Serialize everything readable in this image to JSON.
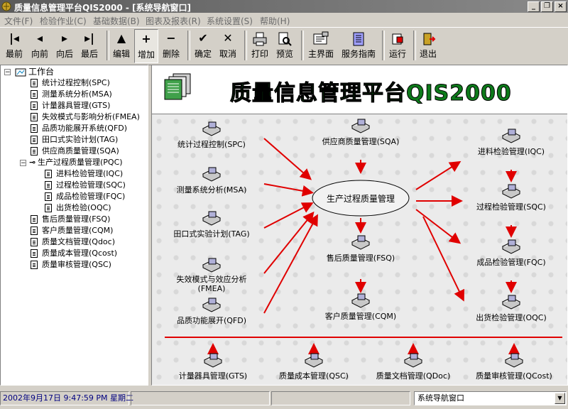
{
  "window": {
    "title": "质量信息管理平台QIS2000 - [系统导航窗口]",
    "controls": {
      "minimize": "_",
      "restore": "❐",
      "close": "×"
    }
  },
  "menu": [
    {
      "label": "文件(F)"
    },
    {
      "label": "检验作业(C)"
    },
    {
      "label": "基础数据(B)"
    },
    {
      "label": "图表及报表(R)"
    },
    {
      "label": "系统设置(S)"
    },
    {
      "label": "帮助(H)"
    }
  ],
  "toolbar": {
    "first": "最前",
    "prev": "向前",
    "next": "向后",
    "last": "最后",
    "edit": "编辑",
    "add": "增加",
    "delete": "删除",
    "confirm": "确定",
    "cancel": "取消",
    "print": "打印",
    "preview": "预览",
    "main": "主界面",
    "service": "服务指南",
    "run": "运行",
    "exit": "退出"
  },
  "tree": {
    "root": "工作台",
    "items": [
      {
        "label": "统计过程控制(SPC)"
      },
      {
        "label": "测量系统分析(MSA)"
      },
      {
        "label": "计量器具管理(GTS)"
      },
      {
        "label": "失效模式与影响分析(FMEA)"
      },
      {
        "label": "品质功能展开系统(QFD)"
      },
      {
        "label": "田口式实验计划(TAG)"
      },
      {
        "label": "供应商质量管理(SQA)"
      },
      {
        "label": "生产过程质量管理(PQC)"
      },
      {
        "label": "进料检验管理(IQC)"
      },
      {
        "label": "过程检验管理(SQC)"
      },
      {
        "label": "成品检验管理(FQC)"
      },
      {
        "label": "出货检验(OQC)"
      },
      {
        "label": "售后质量管理(FSQ)"
      },
      {
        "label": "客户质量管理(CQM)"
      },
      {
        "label": "质量文档管理(Qdoc)"
      },
      {
        "label": "质量成本管理(Qcost)"
      },
      {
        "label": "质量审核管理(QSC)"
      }
    ]
  },
  "banner": {
    "title": "质量信息管理平台QIS2000"
  },
  "diagram": {
    "spc": "统计过程控制(SPC)",
    "msa": "测量系统分析(MSA)",
    "tag": "田口式实验计划(TAG)",
    "fmea_line1": "失效模式与效应分析",
    "fmea_line2": "(FMEA)",
    "qfd": "品质功能展开(QFD)",
    "sqa": "供应商质量管理(SQA)",
    "pqc": "生产过程质量管理",
    "fsq": "售后质量管理(FSQ)",
    "cqm": "客户质量管理(CQM)",
    "iqc": "进料检验管理(IQC)",
    "sqc": "过程检验管理(SQC)",
    "fqc": "成品检验管理(FQC)",
    "oqc": "出货检验管理(OQC)",
    "gts": "计量器具管理(GTS)",
    "qsc": "质量成本管理(QSC)",
    "qdoc": "质量文档管理(QDoc)",
    "qcost": "质量审核管理(QCost)"
  },
  "status": {
    "datetime": "2002年9月17日 9:47:59 PM 星期二",
    "window_select": "系统导航窗口"
  },
  "colors": {
    "arrow": "#e00000",
    "banner_text": "#0d7a1a"
  }
}
